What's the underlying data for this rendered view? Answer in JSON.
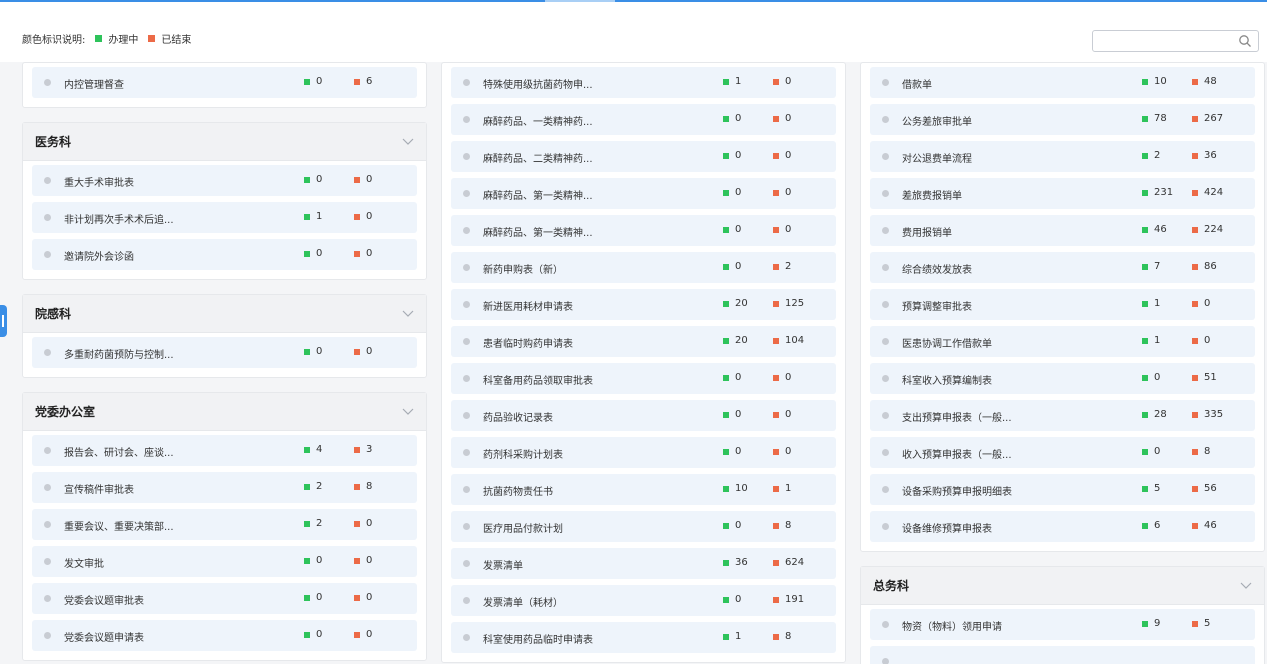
{
  "legend": {
    "label": "颜色标识说明:",
    "in_progress": "办理中",
    "finished": "已结束",
    "in_progress_color": "#2ec35b",
    "finished_color": "#ec6a47"
  },
  "search": {
    "placeholder": "",
    "value": ""
  },
  "col1": [
    {
      "title": "",
      "items": [
        {
          "name": "内控管理督查",
          "active": "0",
          "done": "6"
        }
      ]
    },
    {
      "title": "医务科",
      "items": [
        {
          "name": "重大手术审批表",
          "active": "0",
          "done": "0"
        },
        {
          "name": "非计划再次手术术后追...",
          "active": "1",
          "done": "0"
        },
        {
          "name": "邀请院外会诊函",
          "active": "0",
          "done": "0"
        }
      ]
    },
    {
      "title": "院感科",
      "items": [
        {
          "name": "多重耐药菌预防与控制...",
          "active": "0",
          "done": "0"
        }
      ]
    },
    {
      "title": "党委办公室",
      "items": [
        {
          "name": "报告会、研讨会、座谈...",
          "active": "4",
          "done": "3"
        },
        {
          "name": "宣传稿件审批表",
          "active": "2",
          "done": "8"
        },
        {
          "name": "重要会议、重要决策部...",
          "active": "2",
          "done": "0"
        },
        {
          "name": "发文审批",
          "active": "0",
          "done": "0"
        },
        {
          "name": "党委会议题审批表",
          "active": "0",
          "done": "0"
        },
        {
          "name": "党委会议题申请表",
          "active": "0",
          "done": "0"
        }
      ]
    }
  ],
  "col2": [
    {
      "title": "",
      "items": [
        {
          "name": "特殊使用级抗菌药物申...",
          "active": "1",
          "done": "0"
        },
        {
          "name": "麻醉药品、一类精神药...",
          "active": "0",
          "done": "0"
        },
        {
          "name": "麻醉药品、二类精神药...",
          "active": "0",
          "done": "0"
        },
        {
          "name": "麻醉药品、第一类精神...",
          "active": "0",
          "done": "0"
        },
        {
          "name": "麻醉药品、第一类精神...",
          "active": "0",
          "done": "0"
        },
        {
          "name": "新药申购表（新）",
          "active": "0",
          "done": "2"
        },
        {
          "name": "新进医用耗材申请表",
          "active": "20",
          "done": "125"
        },
        {
          "name": "患者临时购药申请表",
          "active": "20",
          "done": "104"
        },
        {
          "name": "科室备用药品领取审批表",
          "active": "0",
          "done": "0"
        },
        {
          "name": "药品验收记录表",
          "active": "0",
          "done": "0"
        },
        {
          "name": "药剂科采购计划表",
          "active": "0",
          "done": "0"
        },
        {
          "name": "抗菌药物责任书",
          "active": "10",
          "done": "1"
        },
        {
          "name": "医疗用品付款计划",
          "active": "0",
          "done": "8"
        },
        {
          "name": "发票清单",
          "active": "36",
          "done": "624"
        },
        {
          "name": "发票清单（耗材）",
          "active": "0",
          "done": "191"
        },
        {
          "name": "科室使用药品临时申请表",
          "active": "1",
          "done": "8"
        }
      ]
    }
  ],
  "col3": [
    {
      "title": "",
      "items": [
        {
          "name": "借款单",
          "active": "10",
          "done": "48"
        },
        {
          "name": "公务差旅审批单",
          "active": "78",
          "done": "267"
        },
        {
          "name": "对公退费单流程",
          "active": "2",
          "done": "36"
        },
        {
          "name": "差旅费报销单",
          "active": "231",
          "done": "424"
        },
        {
          "name": "费用报销单",
          "active": "46",
          "done": "224"
        },
        {
          "name": "综合绩效发放表",
          "active": "7",
          "done": "86"
        },
        {
          "name": "预算调整审批表",
          "active": "1",
          "done": "0"
        },
        {
          "name": "医患协调工作借款单",
          "active": "1",
          "done": "0"
        },
        {
          "name": "科室收入预算编制表",
          "active": "0",
          "done": "51"
        },
        {
          "name": "支出预算申报表（一般...",
          "active": "28",
          "done": "335"
        },
        {
          "name": "收入预算申报表（一般...",
          "active": "0",
          "done": "8"
        },
        {
          "name": "设备采购预算申报明细表",
          "active": "5",
          "done": "56"
        },
        {
          "name": "设备维修预算申报表",
          "active": "6",
          "done": "46"
        }
      ]
    },
    {
      "title": "总务科",
      "items": [
        {
          "name": "物资（物料）领用申请",
          "active": "9",
          "done": "5"
        },
        {
          "name": "",
          "active": "",
          "done": ""
        }
      ]
    }
  ]
}
